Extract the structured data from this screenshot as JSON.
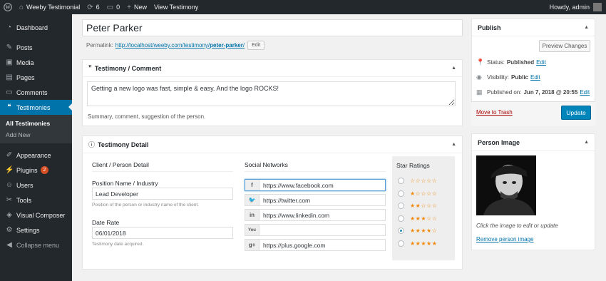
{
  "adminbar": {
    "site_name": "Weeby Testimonial",
    "updates_count": "6",
    "comments_count": "0",
    "new_label": "New",
    "view_label": "View Testimony",
    "greeting": "Howdy, admin"
  },
  "sidebar": {
    "items": [
      {
        "label": "Dashboard",
        "icon": "dashboard-icon"
      },
      {
        "label": "Posts",
        "icon": "pin-icon"
      },
      {
        "label": "Media",
        "icon": "media-icon"
      },
      {
        "label": "Pages",
        "icon": "pages-icon"
      },
      {
        "label": "Comments",
        "icon": "comments-icon"
      },
      {
        "label": "Testimonies",
        "icon": "testimonies-icon"
      }
    ],
    "submenu": [
      "All Testimonies",
      "Add New"
    ],
    "items2": [
      {
        "label": "Appearance",
        "icon": "brush-icon"
      },
      {
        "label": "Plugins",
        "icon": "plugin-icon",
        "badge": "2"
      },
      {
        "label": "Users",
        "icon": "users-icon"
      },
      {
        "label": "Tools",
        "icon": "wrench-icon"
      },
      {
        "label": "Visual Composer",
        "icon": "vc-icon"
      },
      {
        "label": "Settings",
        "icon": "settings-icon"
      },
      {
        "label": "Collapse menu",
        "icon": "collapse-icon"
      }
    ]
  },
  "post": {
    "title": "Peter Parker",
    "permalink_label": "Permalink:",
    "permalink_base": "http://localhost/weeby.com/testimony/",
    "permalink_slug": "peter-parker",
    "permalink_end": "/",
    "edit_label": "Edit"
  },
  "testimony_box": {
    "title": "Testimony / Comment",
    "text": "Getting a new logo was fast, simple & easy. And the logo ROCKS!",
    "hint": "Summary, comment, suggestion of the person."
  },
  "detail_box": {
    "title": "Testimony Detail",
    "client_head": "Client / Person Detail",
    "position_label": "Position Name / Industry",
    "position_value": "Lead Developer",
    "position_hint": "Position of the person or industry name of the client.",
    "date_label": "Date Rate",
    "date_value": "06/01/2018",
    "date_hint": "Testimony date acquired.",
    "social_head": "Social Networks",
    "social": [
      {
        "icon": "facebook-icon",
        "glyph": "f",
        "value": "https://www.facebook.com"
      },
      {
        "icon": "twitter-icon",
        "glyph": "t",
        "value": "https://twitter.com"
      },
      {
        "icon": "linkedin-icon",
        "glyph": "in",
        "value": "https://www.linkedin.com"
      },
      {
        "icon": "youtube-icon",
        "glyph": "You",
        "value": ""
      },
      {
        "icon": "googleplus-icon",
        "glyph": "g+",
        "value": "https://plus.google.com"
      }
    ],
    "ratings_head": "Star Ratings",
    "ratings": [
      0,
      1,
      2,
      3,
      4,
      5
    ],
    "selected_rating": 4
  },
  "publish": {
    "title": "Publish",
    "preview_label": "Preview Changes",
    "status_label": "Status:",
    "status_value": "Published",
    "visibility_label": "Visibility:",
    "visibility_value": "Public",
    "published_label": "Published on:",
    "published_value": "Jun 7, 2018 @ 20:55",
    "edit_label": "Edit",
    "trash_label": "Move to Trash",
    "update_label": "Update"
  },
  "person_image": {
    "title": "Person Image",
    "caption": "Click the image to edit or update",
    "remove_label": "Remove person image"
  },
  "colors": {
    "accent": "#0073aa",
    "admin_dark": "#23282d",
    "star": "#f0890c",
    "update_button": "#0085ba"
  }
}
